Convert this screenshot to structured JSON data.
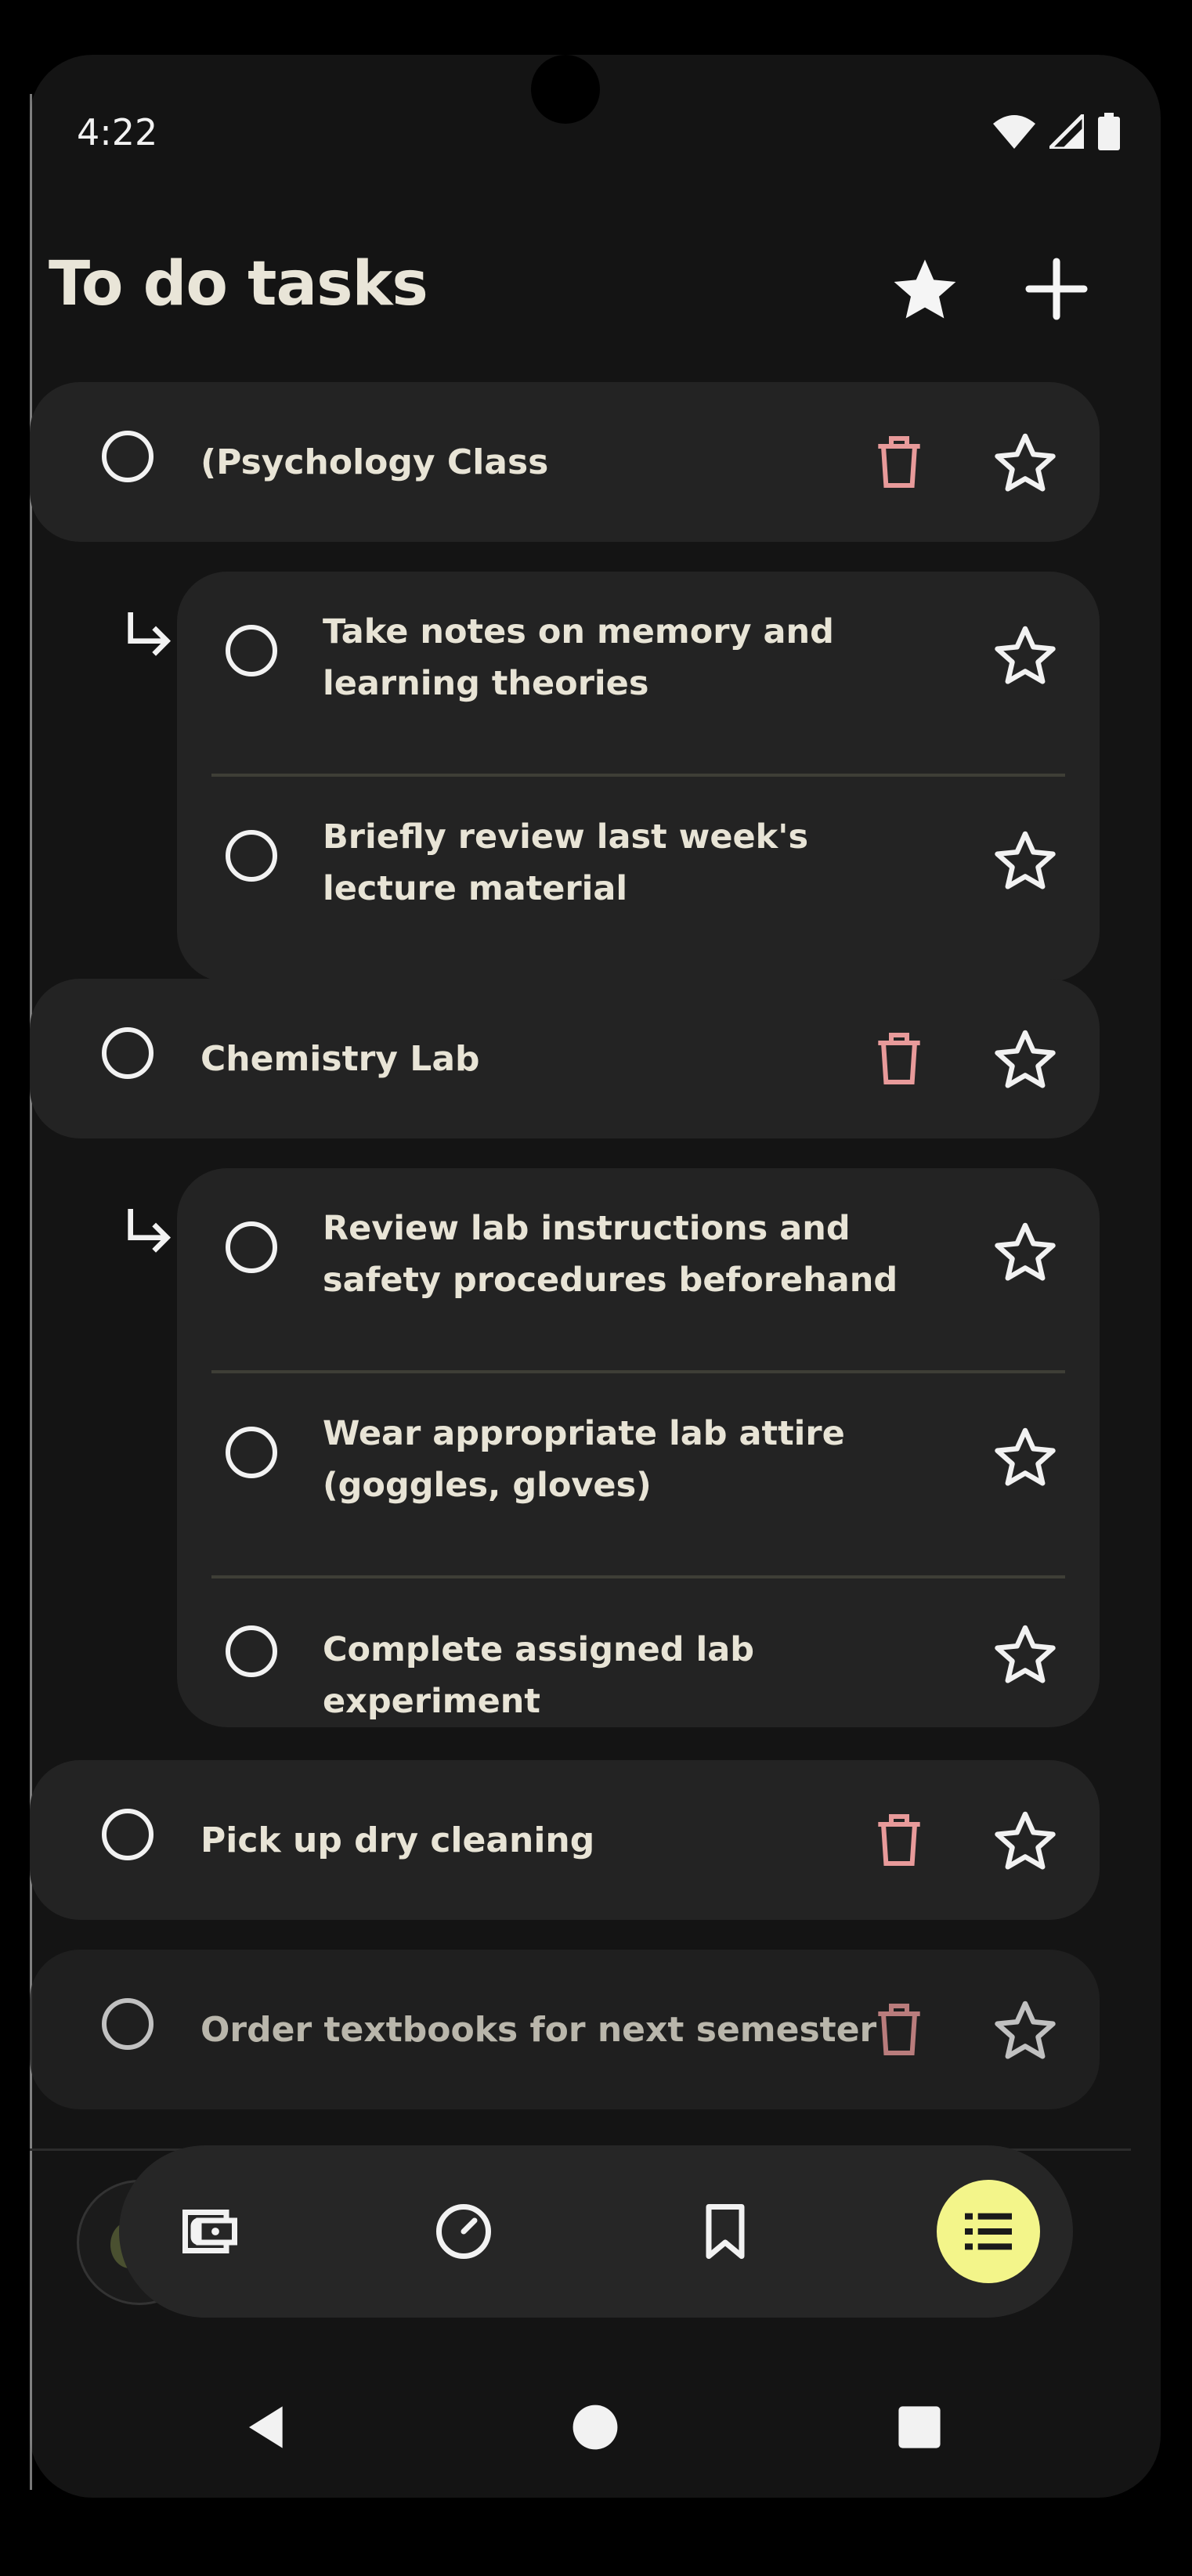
{
  "status": {
    "time": "4:22"
  },
  "header": {
    "title": "To do tasks"
  },
  "tasks": [
    {
      "label": "(Psychology Class",
      "subtasks": [
        {
          "label": "Take notes on memory and learning theories"
        },
        {
          "label": "Briefly review last week's lecture material"
        }
      ]
    },
    {
      "label": "Chemistry Lab",
      "subtasks": [
        {
          "label": "Review lab instructions and safety procedures beforehand"
        },
        {
          "label": "Wear appropriate lab attire (goggles, gloves)"
        },
        {
          "label": "Complete assigned lab experiment"
        }
      ]
    },
    {
      "label": "Pick up dry cleaning",
      "subtasks": []
    },
    {
      "label": "Order textbooks for next semester",
      "subtasks": []
    }
  ],
  "icons": {
    "status": [
      "wifi-icon",
      "cellular-signal-icon",
      "battery-icon"
    ],
    "header": [
      "star-filled-icon",
      "plus-icon"
    ],
    "task_actions": [
      "radio-unchecked-icon",
      "trash-icon",
      "star-outline-icon",
      "subdirectory-arrow-icon"
    ],
    "bottom_nav": [
      "wallet-icon",
      "timer-icon",
      "bookmark-icon",
      "list-icon"
    ],
    "system_nav": [
      "back-icon",
      "home-icon",
      "recents-icon"
    ]
  },
  "colors": {
    "background": "#141414",
    "card": "#232323",
    "text": "#E8E4D6",
    "trash": "#E89A9A",
    "active_nav": "#F3F58A"
  }
}
